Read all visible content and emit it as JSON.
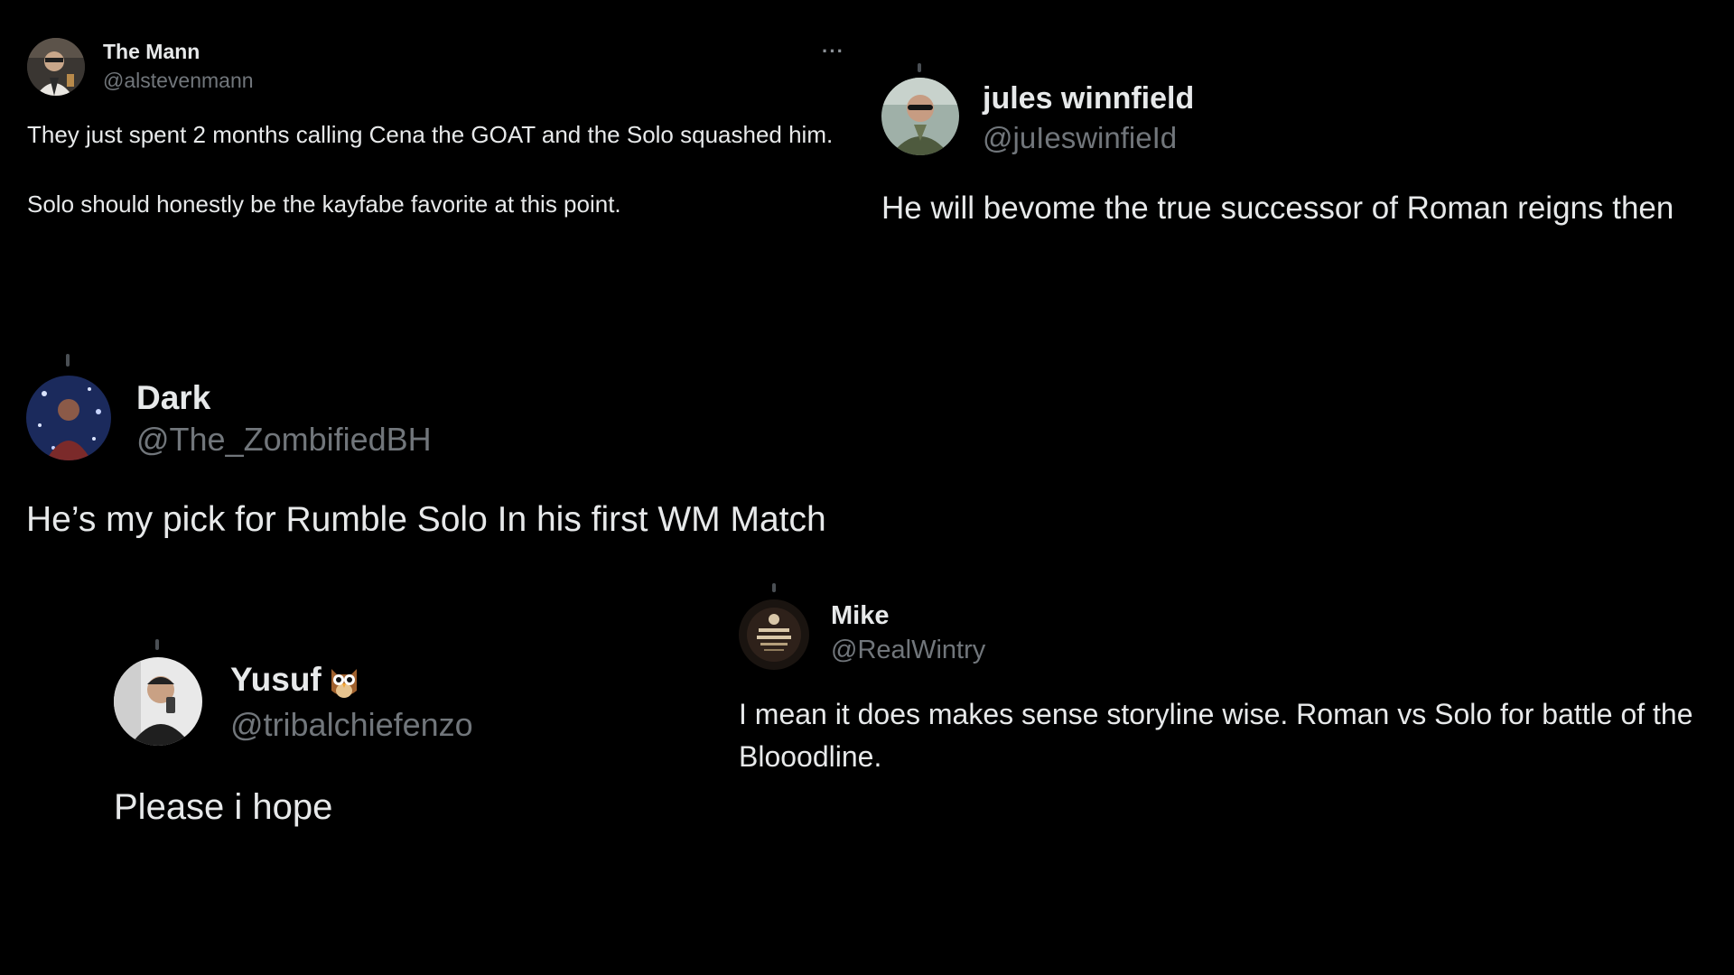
{
  "tweets": [
    {
      "name": "The Mann",
      "handle": "@alstevenmann",
      "more_icon": "more-horizontal-icon",
      "paragraphs": [
        "They just spent 2 months calling Cena the GOAT and the Solo squashed him.",
        "Solo should honestly be the kayfabe favorite at this point."
      ]
    },
    {
      "name": "jules winnfield",
      "handle": "@juIeswinfieId",
      "text": "He will bevome the true successor of Roman reigns then"
    },
    {
      "name": "Dark",
      "handle": "@The_ZombifiedBH",
      "text": "He’s my pick for Rumble Solo In his first WM Match"
    },
    {
      "name": "Yusuf",
      "handle": "@tribalchiefenzo",
      "emoji_icon": "owl-icon",
      "text": "Please i hope"
    },
    {
      "name": "Mike",
      "handle": "@RealWintry",
      "text": "I mean it does makes sense storyline wise. Roman vs Solo for battle of the Blooodline."
    }
  ],
  "colors": {
    "background": "#000000",
    "primary_text": "#e7e9ea",
    "secondary_text": "#71767b"
  }
}
